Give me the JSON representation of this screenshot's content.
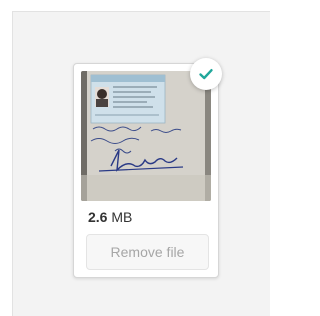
{
  "file": {
    "size_value": "2.6",
    "size_unit": "MB",
    "remove_label": "Remove file",
    "status": "uploaded"
  },
  "colors": {
    "success": "#21a79b",
    "button_text": "#a6a6a6",
    "dropzone_bg": "#f3f3f3"
  },
  "icons": {
    "status": "checkmark-icon",
    "thumbnail": "document-photo-thumbnail"
  }
}
